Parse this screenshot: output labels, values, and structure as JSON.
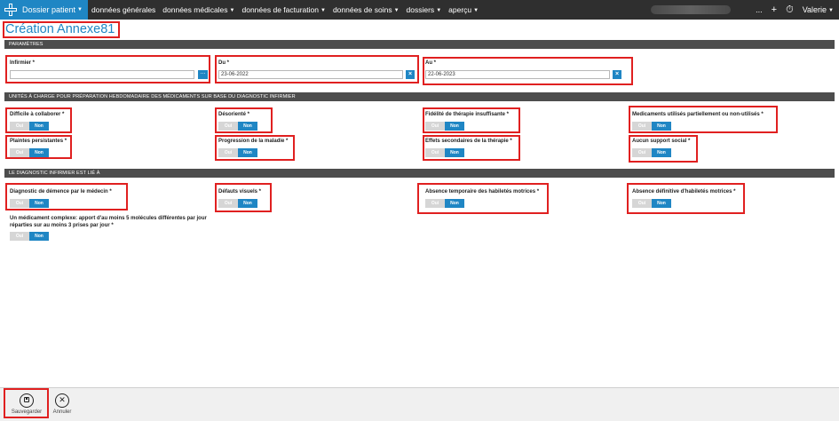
{
  "nav": {
    "brand": "Dossier patient",
    "items": [
      "données générales",
      "données médicales",
      "données de facturation",
      "données de soins",
      "dossiers",
      "aperçu"
    ],
    "more": "...",
    "add": "+",
    "user": "Valerie"
  },
  "page": {
    "title": "Création Annexe81"
  },
  "sections": {
    "parametres": "PARAMÈTRES",
    "unites": "UNITÉS À CHARGE POUR PRÉPARATION HEBDOMADAIRE DES MÉDICAMENTS SUR BASE DU DIAGNOSTIC INFIRMIER",
    "diagnostic": "LE DIAGNOSTIC INFIRMIER EST LIÉ À"
  },
  "params": {
    "infirmier_label": "Infirmier *",
    "infirmier_value": "",
    "dots": "...",
    "du_label": "Du *",
    "du_value": "23-06-2022",
    "au_label": "Au *",
    "au_value": "22-06-2023",
    "clear": "×"
  },
  "toggle": {
    "oui": "Oui",
    "non": "Non"
  },
  "fields": {
    "f1": "Difficile à collaborer *",
    "f2": "Désorienté *",
    "f3": "Fidélité de thérapie insuffisante *",
    "f4": "Medicaments utilisés partiellement ou non-utilisés *",
    "f5": "Plaintes persistantes *",
    "f6": "Progression de la maladie *",
    "f7": "Effets secondaires de la thérapie *",
    "f8": "Aucun support social *",
    "f9": "Diagnostic de démence par le médecin *",
    "f10": "Défauts visuels *",
    "f11": "Absence temporaire des habiletés motrices *",
    "f12": "Absence définitive d'habiletés motrices *",
    "f13": "Un médicament complexe: apport d'au moins 5 molécules différentes par jour réparties sur au moins 3 prises par jour *"
  },
  "toolbar": {
    "save": "Sauvegarder",
    "cancel": "Annuler"
  },
  "colors": {
    "accent": "#1f86c4",
    "highlight": "#e02020",
    "header": "#4d4d4d"
  }
}
